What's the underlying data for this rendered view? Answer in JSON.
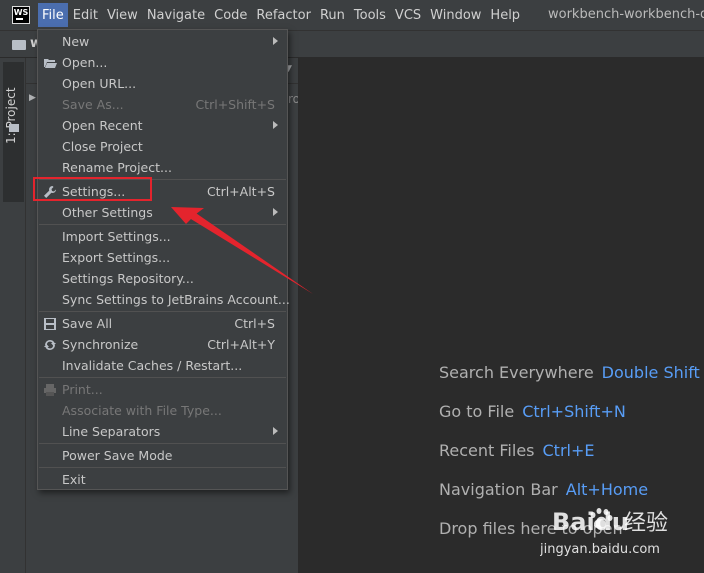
{
  "menubar": {
    "logo": "WS",
    "items": [
      "File",
      "Edit",
      "View",
      "Navigate",
      "Code",
      "Refactor",
      "Run",
      "Tools",
      "VCS",
      "Window",
      "Help"
    ],
    "active": "File",
    "window_title": "workbench-workbench-dev"
  },
  "navbar": {
    "project_initial": "w"
  },
  "tool_strip": {
    "project_tab": "1: Project"
  },
  "project_panel": {
    "truncated_text": "ro"
  },
  "file_menu": {
    "items": [
      {
        "label": "New",
        "submenu": true
      },
      {
        "label": "Open...",
        "icon": "folder-open-icon"
      },
      {
        "label": "Open URL..."
      },
      {
        "label": "Save As...",
        "shortcut": "Ctrl+Shift+S",
        "disabled": true
      },
      {
        "label": "Open Recent",
        "submenu": true
      },
      {
        "label": "Close Project"
      },
      {
        "label": "Rename Project..."
      },
      {
        "label": "Settings...",
        "shortcut": "Ctrl+Alt+S",
        "icon": "wrench-icon"
      },
      {
        "label": "Other Settings",
        "submenu": true
      },
      {
        "label": "Import Settings..."
      },
      {
        "label": "Export Settings..."
      },
      {
        "label": "Settings Repository..."
      },
      {
        "label": "Sync Settings to JetBrains Account..."
      },
      {
        "label": "Save All",
        "shortcut": "Ctrl+S",
        "icon": "floppy-disk-icon"
      },
      {
        "label": "Synchronize",
        "shortcut": "Ctrl+Alt+Y",
        "icon": "sync-icon"
      },
      {
        "label": "Invalidate Caches / Restart..."
      },
      {
        "label": "Print...",
        "icon": "printer-icon",
        "disabled": true
      },
      {
        "label": "Associate with File Type...",
        "disabled": true
      },
      {
        "label": "Line Separators",
        "submenu": true
      },
      {
        "label": "Power Save Mode"
      },
      {
        "label": "Exit"
      }
    ]
  },
  "editor_hints": [
    {
      "label": "Search Everywhere",
      "key": "Double Shift"
    },
    {
      "label": "Go to File",
      "key": "Ctrl+Shift+N"
    },
    {
      "label": "Recent Files",
      "key": "Ctrl+E"
    },
    {
      "label": "Navigation Bar",
      "key": "Alt+Home"
    },
    {
      "label": "Drop files here to open",
      "key": ""
    }
  ],
  "watermark": {
    "brand": "Baidu",
    "suffix": "经验",
    "url": "jingyan.baidu.com"
  },
  "colors": {
    "menu_bg": "#3c3f41",
    "editor_bg": "#2b2b2b",
    "active_menu": "#4b6eaf",
    "shortcut_blue": "#589df6",
    "annotation_red": "#e4242d"
  }
}
